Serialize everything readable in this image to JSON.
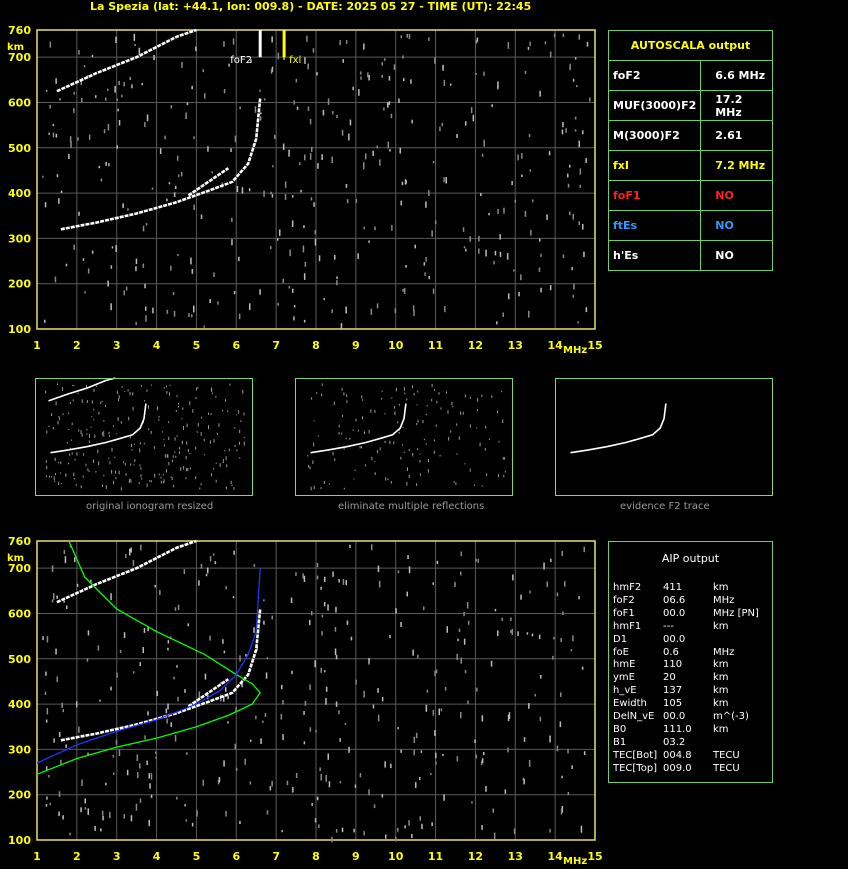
{
  "header": {
    "title": "La Spezia (lat: +44.1, lon: 009.8) - DATE: 2025 05 27 - TIME (UT): 22:45"
  },
  "chart_data": [
    {
      "type": "scatter",
      "id": "top-ionogram",
      "xlabel": "MHz",
      "ylabel": "km",
      "xlim": [
        1,
        15
      ],
      "ylim": [
        100,
        760
      ],
      "xticks": [
        "1",
        "2",
        "3",
        "4",
        "5",
        "6",
        "7",
        "8",
        "9",
        "10",
        "11",
        "12",
        "13",
        "14",
        "15"
      ],
      "yticks": [
        "100",
        "200",
        "300",
        "400",
        "500",
        "600",
        "700",
        "760"
      ],
      "grid": true,
      "markers": [
        {
          "label": "foF2",
          "x": 6.6,
          "color": "#ffffff"
        },
        {
          "label": "fxl",
          "x": 7.2,
          "color": "#ffff00"
        }
      ],
      "series": [
        {
          "trace": "o-mode F2",
          "points": [
            [
              1.6,
              320
            ],
            [
              2.5,
              335
            ],
            [
              3.5,
              355
            ],
            [
              4.5,
              380
            ],
            [
              5.3,
              405
            ],
            [
              5.9,
              425
            ],
            [
              6.3,
              465
            ],
            [
              6.5,
              520
            ],
            [
              6.6,
              610
            ]
          ]
        },
        {
          "trace": "x-mode F2",
          "points": [
            [
              4.8,
              395
            ],
            [
              5.3,
              425
            ],
            [
              5.8,
              455
            ]
          ]
        },
        {
          "trace": "multiple reflection",
          "points": [
            [
              1.5,
              625
            ],
            [
              2.5,
              665
            ],
            [
              3.5,
              700
            ],
            [
              4.5,
              745
            ],
            [
              5.0,
              760
            ]
          ]
        }
      ]
    },
    {
      "type": "line",
      "id": "bottom-ionogram",
      "xlabel": "MHz",
      "ylabel": "km",
      "xlim": [
        1,
        15
      ],
      "ylim": [
        100,
        760
      ],
      "xticks": [
        "1",
        "2",
        "3",
        "4",
        "5",
        "6",
        "7",
        "8",
        "9",
        "10",
        "11",
        "12",
        "13",
        "14",
        "15"
      ],
      "yticks": [
        "100",
        "200",
        "300",
        "400",
        "500",
        "600",
        "700",
        "760"
      ],
      "grid": true,
      "series": [
        {
          "trace": "o-mode F2",
          "points": [
            [
              1.6,
              320
            ],
            [
              2.5,
              335
            ],
            [
              3.5,
              355
            ],
            [
              4.5,
              380
            ],
            [
              5.3,
              405
            ],
            [
              5.9,
              425
            ],
            [
              6.3,
              465
            ],
            [
              6.5,
              520
            ],
            [
              6.6,
              610
            ]
          ]
        },
        {
          "trace": "x-mode F2",
          "points": [
            [
              4.8,
              395
            ],
            [
              5.3,
              425
            ],
            [
              5.8,
              455
            ]
          ]
        },
        {
          "trace": "multiple reflection",
          "points": [
            [
              1.5,
              625
            ],
            [
              2.5,
              665
            ],
            [
              3.5,
              700
            ],
            [
              4.5,
              745
            ],
            [
              5.0,
              760
            ]
          ]
        },
        {
          "trace": "AIP profile (green)",
          "color": "#00ff00",
          "points": [
            [
              1.0,
              245
            ],
            [
              2.0,
              280
            ],
            [
              3.0,
              305
            ],
            [
              4.0,
              325
            ],
            [
              5.0,
              350
            ],
            [
              5.8,
              375
            ],
            [
              6.4,
              400
            ],
            [
              6.6,
              425
            ],
            [
              6.4,
              445
            ],
            [
              6.0,
              465
            ],
            [
              5.2,
              510
            ],
            [
              4.0,
              560
            ],
            [
              3.0,
              610
            ],
            [
              2.2,
              680
            ],
            [
              1.8,
              760
            ]
          ]
        },
        {
          "trace": "AIP fit (blue)",
          "color": "#2233ff",
          "points": [
            [
              1.0,
              270
            ],
            [
              2.0,
              310
            ],
            [
              3.0,
              340
            ],
            [
              4.0,
              365
            ],
            [
              5.0,
              400
            ],
            [
              5.6,
              430
            ],
            [
              6.0,
              465
            ],
            [
              6.3,
              510
            ],
            [
              6.5,
              560
            ],
            [
              6.6,
              700
            ]
          ]
        }
      ]
    }
  ],
  "thumbnails": [
    {
      "caption": "original ionogram resized"
    },
    {
      "caption": "eliminate multiple reflections"
    },
    {
      "caption": "evidence F2 trace"
    }
  ],
  "autoscala": {
    "title": "AUTOSCALA output",
    "rows": [
      {
        "label": "foF2",
        "value": "6.6 MHz",
        "label_color": "#ffffff",
        "value_color": "#ffffff"
      },
      {
        "label": "MUF(3000)F2",
        "value": "17.2 MHz",
        "label_color": "#ffffff",
        "value_color": "#ffffff"
      },
      {
        "label": "M(3000)F2",
        "value": "2.61",
        "label_color": "#ffffff",
        "value_color": "#ffffff"
      },
      {
        "label": "fxI",
        "value": "7.2 MHz",
        "label_color": "#ffff00",
        "value_color": "#ffff00"
      },
      {
        "label": "foF1",
        "value": "NO",
        "label_color": "#ff2020",
        "value_color": "#ff2020"
      },
      {
        "label": "ftEs",
        "value": "NO",
        "label_color": "#3399ff",
        "value_color": "#3399ff"
      },
      {
        "label": "h'Es",
        "value": "NO",
        "label_color": "#ffffff",
        "value_color": "#ffffff"
      }
    ]
  },
  "aip": {
    "title": "AIP output",
    "rows": [
      {
        "name": "hmF2",
        "value": "411",
        "unit": "km"
      },
      {
        "name": "foF2",
        "value": "06.6",
        "unit": "MHz"
      },
      {
        "name": "foF1",
        "value": "00.0",
        "unit": "MHz  [PN]"
      },
      {
        "name": "hmF1",
        "value": "---",
        "unit": "km"
      },
      {
        "name": "D1",
        "value": "00.0",
        "unit": ""
      },
      {
        "name": "foE",
        "value": "0.6",
        "unit": "MHz"
      },
      {
        "name": "hmE",
        "value": "110",
        "unit": "km"
      },
      {
        "name": "ymE",
        "value": "20",
        "unit": "km"
      },
      {
        "name": "h_vE",
        "value": "137",
        "unit": "km"
      },
      {
        "name": "Ewidth",
        "value": "105",
        "unit": "km"
      },
      {
        "name": "DelN_vE",
        "value": "00.0",
        "unit": "m^(-3)"
      },
      {
        "name": "B0",
        "value": "111.0",
        "unit": "km"
      },
      {
        "name": "B1",
        "value": "03.2",
        "unit": ""
      },
      {
        "name": "TEC[Bot]",
        "value": "004.8",
        "unit": "TECU"
      },
      {
        "name": "TEC[Top]",
        "value": "009.0",
        "unit": "TECU"
      }
    ]
  }
}
